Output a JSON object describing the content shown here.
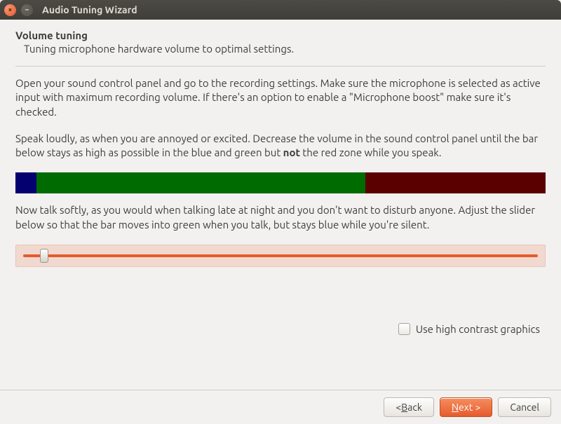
{
  "window": {
    "title": "Audio Tuning Wizard"
  },
  "header": {
    "title": "Volume tuning",
    "subtitle": "Tuning microphone hardware volume to optimal settings."
  },
  "instructions": {
    "p1": "Open your sound control panel and go to the recording settings. Make sure the microphone is selected as active input with maximum recording volume. If there's an option to enable a \"Microphone boost\" make sure it's checked.",
    "p2_a": "Speak loudly, as when you are annoyed or excited. Decrease the volume in the sound control panel until the bar below stays as high as possible in the blue and green but ",
    "p2_strong": "not",
    "p2_b": " the red zone while you speak.",
    "p3": "Now talk softly, as you would when talking late at night and you don't want to disturb anyone. Adjust the slider below so that the bar moves into green when you talk, but stays blue while you're silent."
  },
  "level_meter": {
    "blue_pct": 4,
    "green_pct": 66
  },
  "slider": {
    "value_pct": 4
  },
  "options": {
    "high_contrast_label": "Use high contrast graphics",
    "high_contrast_checked": false
  },
  "footer": {
    "back_prefix": "< ",
    "back_u": "B",
    "back_rest": "ack",
    "next_u": "N",
    "next_rest": "ext >",
    "cancel": "Cancel"
  }
}
